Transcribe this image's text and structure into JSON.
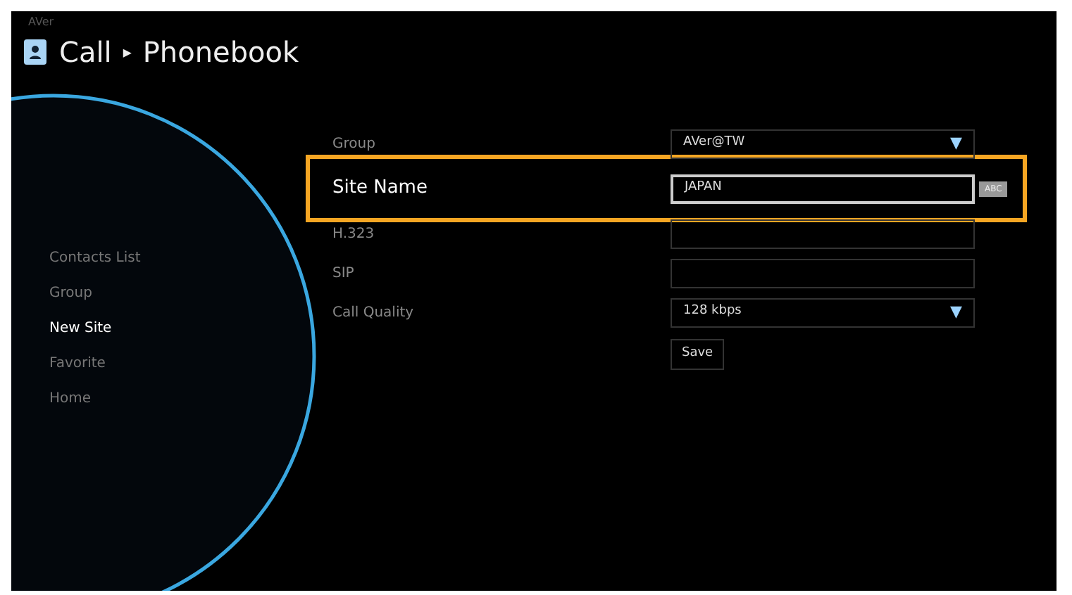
{
  "header": {
    "brand": "AVer",
    "title": "Call",
    "separator": "▸",
    "subtitle": "Phonebook"
  },
  "sidebar": {
    "items": [
      {
        "label": "Contacts List",
        "selected": false
      },
      {
        "label": "Group",
        "selected": false
      },
      {
        "label": "New Site",
        "selected": true
      },
      {
        "label": "Favorite",
        "selected": false
      },
      {
        "label": "Home",
        "selected": false
      }
    ]
  },
  "form": {
    "fields": [
      {
        "label": "Group",
        "kind": "dropdown",
        "value": "AVer@TW",
        "arrow": "▼",
        "focused": false
      },
      {
        "label": "Site Name",
        "kind": "text",
        "value": "JAPAN",
        "input_mode": "ABC",
        "focused": true
      },
      {
        "label": "H.323",
        "kind": "text",
        "focused": false
      },
      {
        "label": "SIP",
        "kind": "text",
        "focused": false
      },
      {
        "label": "Call Quality",
        "kind": "dropdown",
        "value": "128 kbps",
        "arrow": "▼",
        "focused": false
      }
    ],
    "save_button": "Save"
  }
}
